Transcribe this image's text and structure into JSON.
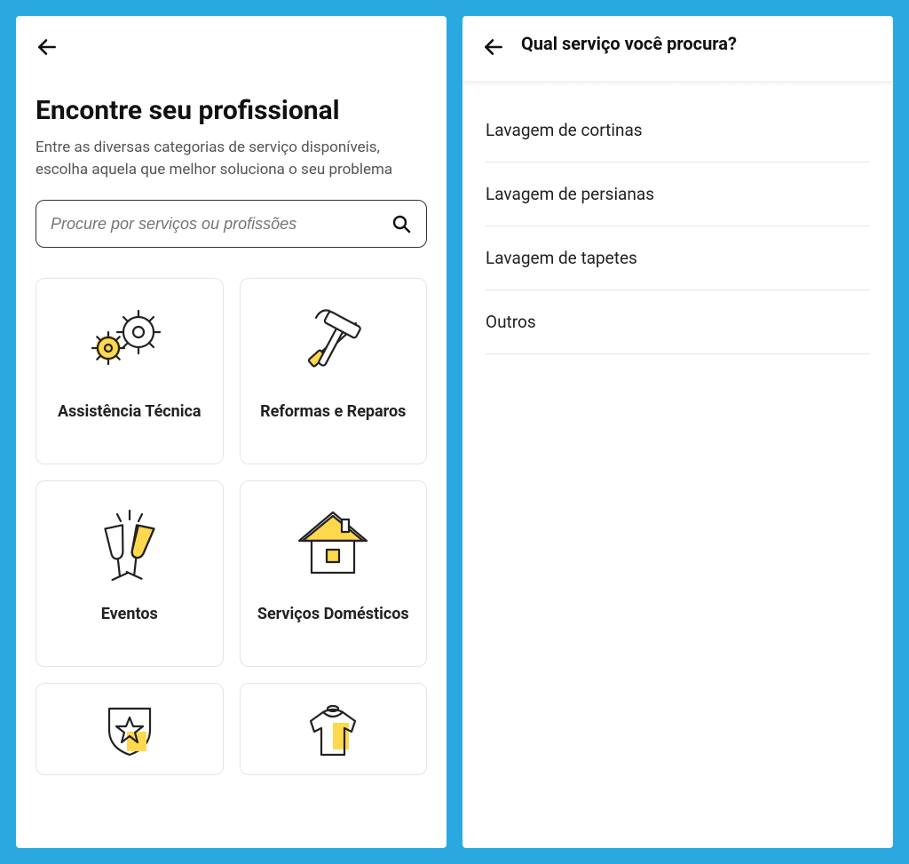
{
  "left": {
    "title": "Encontre seu profissional",
    "subtitle": "Entre as diversas categorias de serviço disponíveis, escolha aquela que melhor soluciona o seu problema",
    "search_placeholder": "Procure por serviços ou profissões",
    "categories": [
      {
        "label": "Assistência Técnica",
        "icon": "gears-icon"
      },
      {
        "label": "Reformas e Reparos",
        "icon": "tools-icon"
      },
      {
        "label": "Eventos",
        "icon": "glasses-icon"
      },
      {
        "label": "Serviços Domésticos",
        "icon": "house-icon"
      },
      {
        "label": "",
        "icon": "shield-star-icon"
      },
      {
        "label": "",
        "icon": "shirt-icon"
      }
    ]
  },
  "right": {
    "header_title": "Qual serviço você procura?",
    "services": [
      "Lavagem de cortinas",
      "Lavagem de persianas",
      "Lavagem de tapetes",
      "Outros"
    ]
  }
}
